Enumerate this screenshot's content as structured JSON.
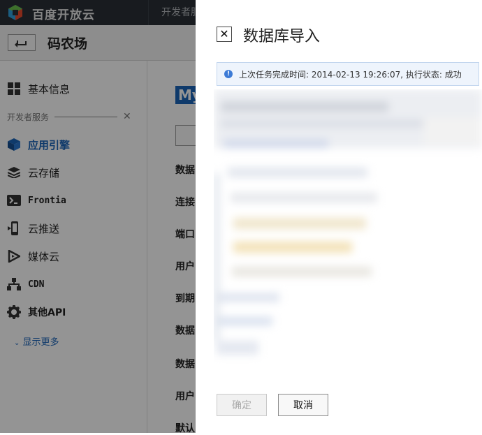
{
  "topbar": {
    "brand": "百度开放云",
    "nav_label": "开发者服"
  },
  "subheader": {
    "title": "码农场"
  },
  "sidebar": {
    "section_label": "开发者服务",
    "items": [
      {
        "label": "基本信息",
        "icon": "grid-icon"
      },
      {
        "label": "应用引擎",
        "icon": "cube-icon",
        "active": true
      },
      {
        "label": "云存储",
        "icon": "layers-icon"
      },
      {
        "label": "Frontia",
        "icon": "terminal-icon"
      },
      {
        "label": "云推送",
        "icon": "phone-push-icon"
      },
      {
        "label": "媒体云",
        "icon": "media-play-icon"
      },
      {
        "label": "CDN",
        "icon": "network-icon"
      },
      {
        "label": "其他API",
        "icon": "gear-icon"
      }
    ],
    "show_more": "显示更多"
  },
  "content": {
    "db_tag": "My",
    "fields": [
      "数据",
      "连接",
      "端口",
      "用户",
      "到期",
      "数据",
      "数据",
      "用户",
      "默认"
    ]
  },
  "dialog": {
    "title": "数据库导入",
    "close_glyph": "✕",
    "info_icon_glyph": "!",
    "info_text": "上次任务完成时间: 2014-02-13 19:26:07, 执行状态: 成功",
    "confirm_label": "确定",
    "cancel_label": "取消"
  },
  "colors": {
    "topbar_bg": "#2a2f36",
    "accent_blue": "#1b64b8",
    "info_bg": "#eef4fc",
    "overlay": "rgba(0,0,0,0.42)"
  }
}
